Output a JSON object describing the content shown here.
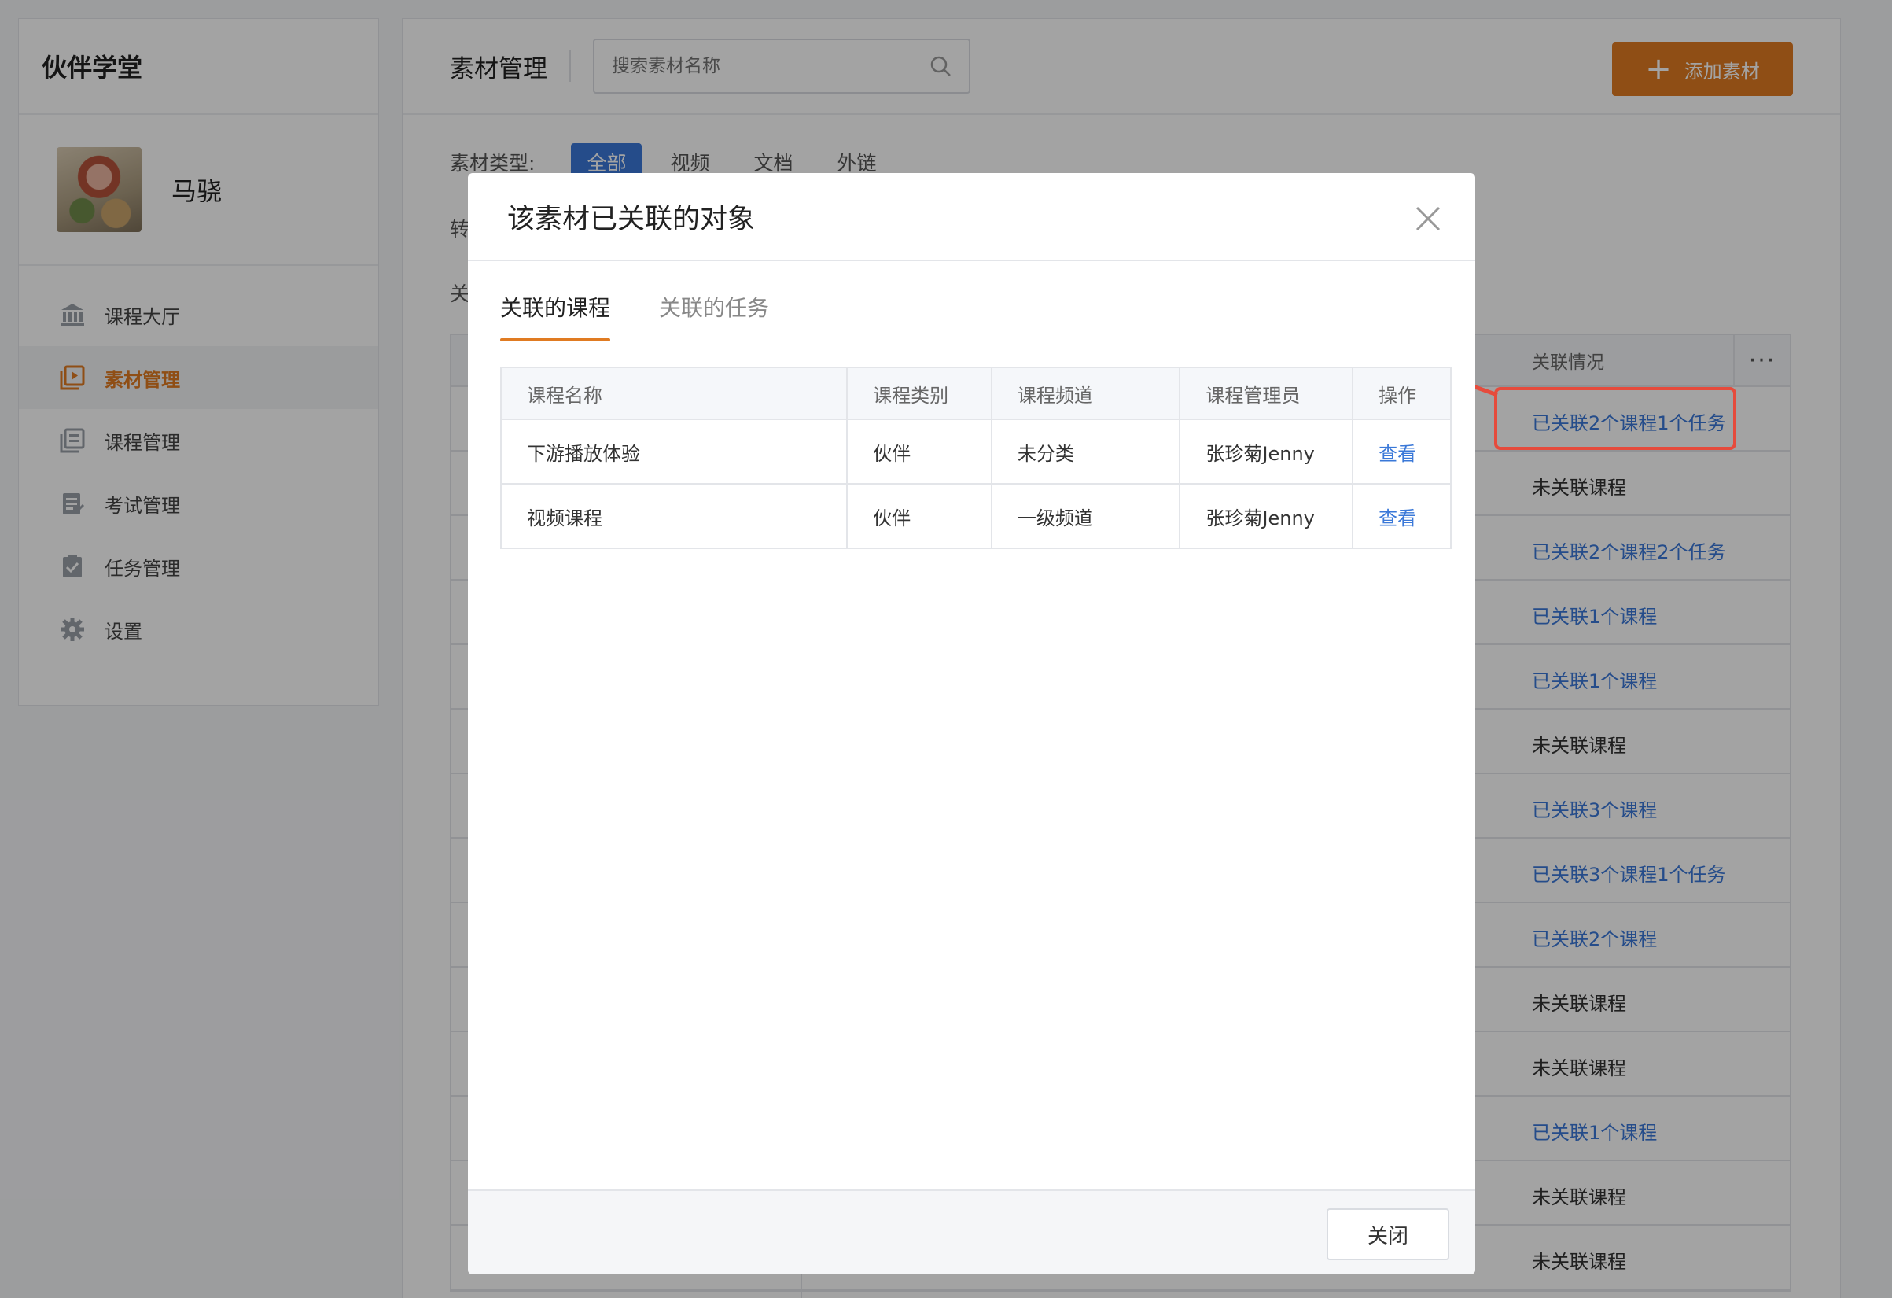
{
  "sidebar": {
    "brand": "伙伴学堂",
    "user_name": "马骁",
    "items": [
      {
        "label": "课程大厅",
        "icon": "bank-icon",
        "active": false
      },
      {
        "label": "素材管理",
        "icon": "media-icon",
        "active": true
      },
      {
        "label": "课程管理",
        "icon": "course-list-icon",
        "active": false
      },
      {
        "label": "考试管理",
        "icon": "exam-icon",
        "active": false
      },
      {
        "label": "任务管理",
        "icon": "task-icon",
        "active": false
      },
      {
        "label": "设置",
        "icon": "gear-icon",
        "active": false
      }
    ]
  },
  "main": {
    "title": "素材管理",
    "search_placeholder": "搜索素材名称",
    "add_button": "添加素材",
    "filter_label": "素材类型:",
    "filters": [
      "全部",
      "视频",
      "文档",
      "外链"
    ],
    "row2_label": "转",
    "row3_label": "关",
    "table": {
      "status_header": "关联情况",
      "more": "···",
      "statuses": [
        "已关联2个课程1个任务",
        "未关联课程",
        "已关联2个课程2个任务",
        "已关联1个课程",
        "已关联1个课程",
        "未关联课程",
        "已关联3个课程",
        "已关联3个课程1个任务",
        "已关联2个课程",
        "未关联课程",
        "未关联课程",
        "已关联1个课程",
        "未关联课程",
        "未关联课程"
      ]
    }
  },
  "modal": {
    "title": "该素材已关联的对象",
    "tabs": [
      "关联的课程",
      "关联的任务"
    ],
    "columns": [
      "课程名称",
      "课程类别",
      "课程频道",
      "课程管理员",
      "操作"
    ],
    "rows": [
      {
        "name": "下游播放体验",
        "category": "伙伴",
        "channel": "未分类",
        "admin": "张珍菊Jenny",
        "action": "查看"
      },
      {
        "name": "视频课程",
        "category": "伙伴",
        "channel": "一级频道",
        "admin": "张珍菊Jenny",
        "action": "查看"
      }
    ],
    "close_button": "关闭"
  },
  "colors": {
    "accent": "#e07b22",
    "link": "#3a78d8",
    "annotation": "#e64b3c"
  }
}
